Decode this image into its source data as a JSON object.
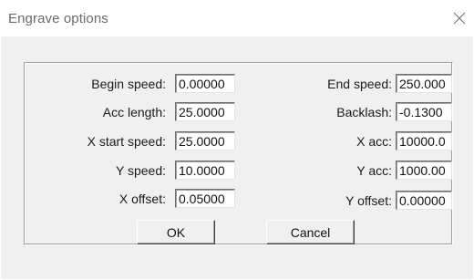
{
  "window": {
    "title": "Engrave options",
    "close_icon": "close-icon"
  },
  "fields": {
    "begin_speed": {
      "label": "Begin speed:",
      "value": "0.00000"
    },
    "acc_length": {
      "label": "Acc length:",
      "value": "25.0000"
    },
    "x_start_speed": {
      "label": "X start speed:",
      "value": "25.0000"
    },
    "y_speed": {
      "label": "Y speed:",
      "value": "10.0000"
    },
    "x_offset": {
      "label": "X offset:",
      "value": "0.05000"
    },
    "end_speed": {
      "label": "End speed:",
      "value": "250.000"
    },
    "backlash": {
      "label": "Backlash:",
      "value": "-0.1300"
    },
    "x_acc": {
      "label": "X acc:",
      "value": "10000.0"
    },
    "y_acc": {
      "label": "Y acc:",
      "value": "1000.00"
    },
    "y_offset": {
      "label": "Y offset:",
      "value": "0.00000"
    }
  },
  "buttons": {
    "ok_label": "OK",
    "cancel_label": "Cancel"
  }
}
